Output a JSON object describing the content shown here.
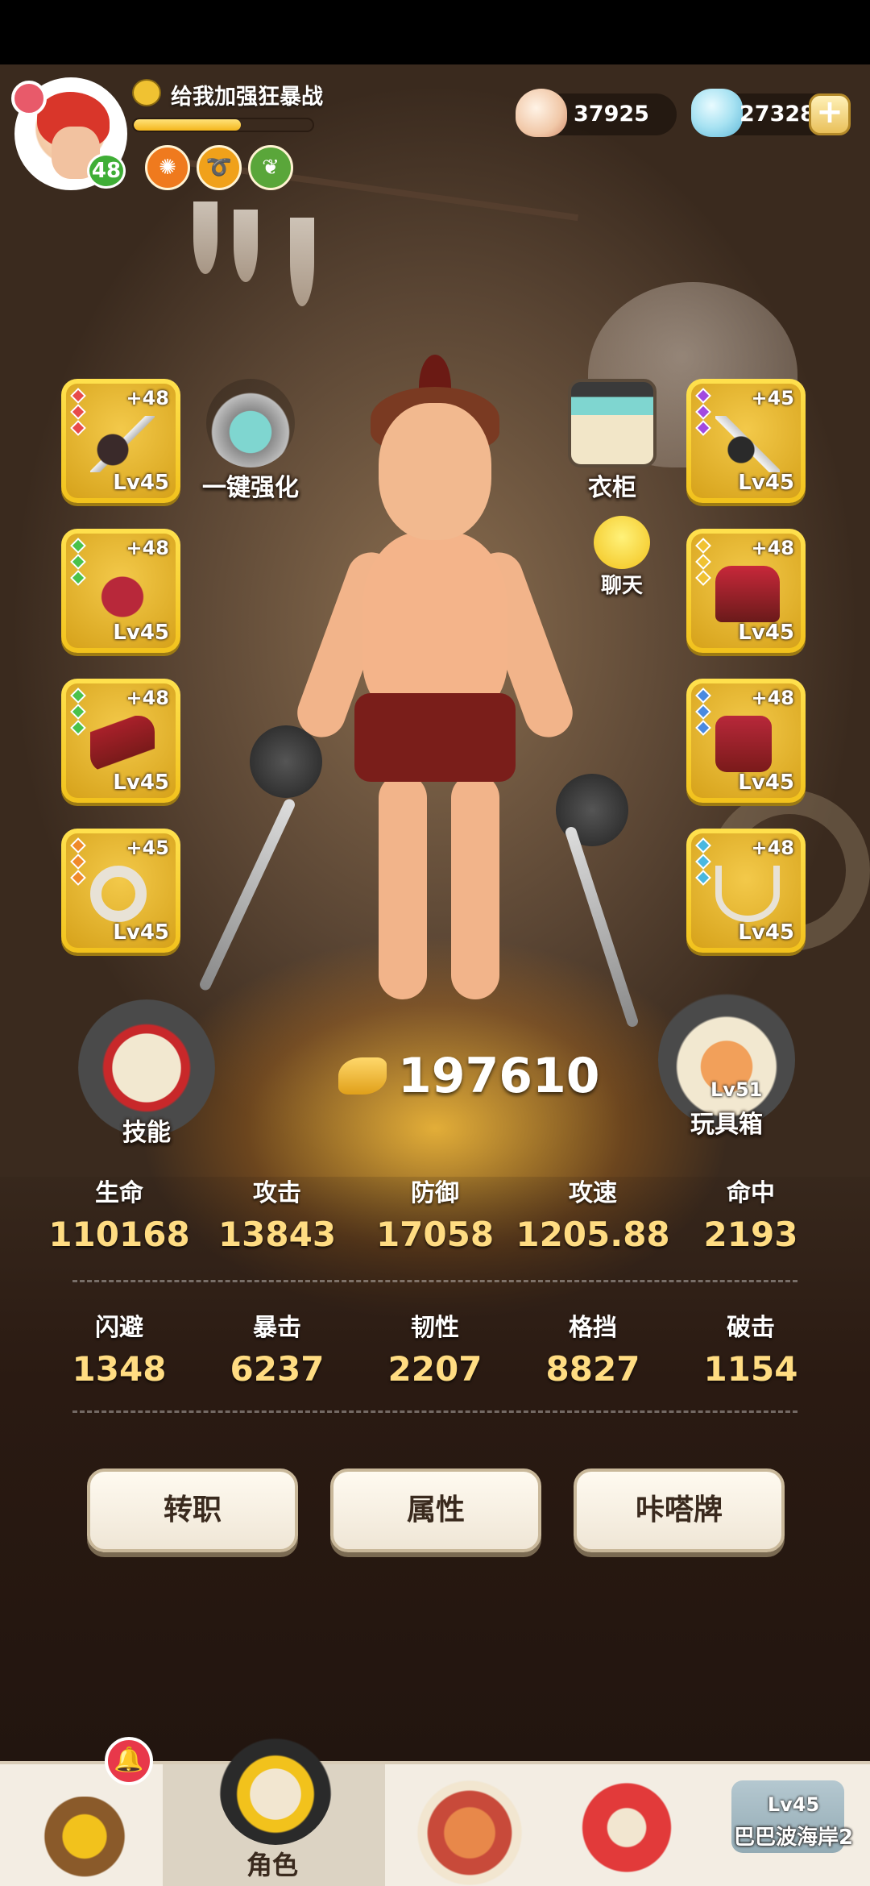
{
  "player": {
    "title": "给我加强狂暴战",
    "level": "48",
    "xp_fraction": 0.6
  },
  "currency": {
    "shells": "37925",
    "crystals": "273287"
  },
  "buffs": [
    {
      "icon": "gear-buff-icon",
      "color": "#ef7a1e"
    },
    {
      "icon": "swirl-buff-icon",
      "color": "#f0a11a"
    },
    {
      "icon": "leaf-buff-icon",
      "color": "#5aa63a"
    }
  ],
  "equipment_left": [
    {
      "plus": "+48",
      "level": "Lv45",
      "gems": [
        "#e84a4a",
        "#e84a4a",
        "#e84a4a"
      ],
      "icon": "mace-icon"
    },
    {
      "plus": "+48",
      "level": "Lv45",
      "gems": [
        "#4ac24a",
        "#4ac24a",
        "#4ac24a"
      ],
      "icon": "boar-helmet-icon"
    },
    {
      "plus": "+48",
      "level": "Lv45",
      "gems": [
        "#4ac24a",
        "#4ac24a",
        "#4ac24a"
      ],
      "icon": "bracer-icon"
    },
    {
      "plus": "+45",
      "level": "Lv45",
      "gems": [
        "#f08a2a",
        "#f08a2a",
        "#f08a2a"
      ],
      "icon": "ring-icon"
    }
  ],
  "equipment_right": [
    {
      "plus": "+45",
      "level": "Lv45",
      "gems": [
        "#a24ae0",
        "#a24ae0",
        "#a24ae0"
      ],
      "icon": "spiked-club-icon"
    },
    {
      "plus": "+48",
      "level": "Lv45",
      "gems": [
        "#f0c232",
        "#f0c232",
        "#f0c232"
      ],
      "icon": "armor-icon"
    },
    {
      "plus": "+48",
      "level": "Lv45",
      "gems": [
        "#4a8ae0",
        "#4a8ae0",
        "#4a8ae0"
      ],
      "icon": "greaves-icon"
    },
    {
      "plus": "+48",
      "level": "Lv45",
      "gems": [
        "#4ab8e0",
        "#4ab8e0",
        "#4ab8e0"
      ],
      "icon": "necklace-icon"
    }
  ],
  "side_buttons": {
    "enhance": "一键强化",
    "wardrobe": "衣柜",
    "chat": "聊天",
    "skill": "技能",
    "toybox": "玩具箱",
    "toybox_level": "Lv51"
  },
  "power": "197610",
  "stats_row1": [
    {
      "label": "生命",
      "value": "110168"
    },
    {
      "label": "攻击",
      "value": "13843"
    },
    {
      "label": "防御",
      "value": "17058"
    },
    {
      "label": "攻速",
      "value": "1205.88"
    },
    {
      "label": "命中",
      "value": "2193"
    }
  ],
  "stats_row2": [
    {
      "label": "闪避",
      "value": "1348"
    },
    {
      "label": "暴击",
      "value": "6237"
    },
    {
      "label": "韧性",
      "value": "2207"
    },
    {
      "label": "格挡",
      "value": "8827"
    },
    {
      "label": "破击",
      "value": "1154"
    }
  ],
  "actions": {
    "job_change": "转职",
    "attributes": "属性",
    "cards": "咔嗒牌"
  },
  "nav": {
    "character": "角色",
    "map_level": "Lv45",
    "map_name": "巴巴波海岸2"
  }
}
